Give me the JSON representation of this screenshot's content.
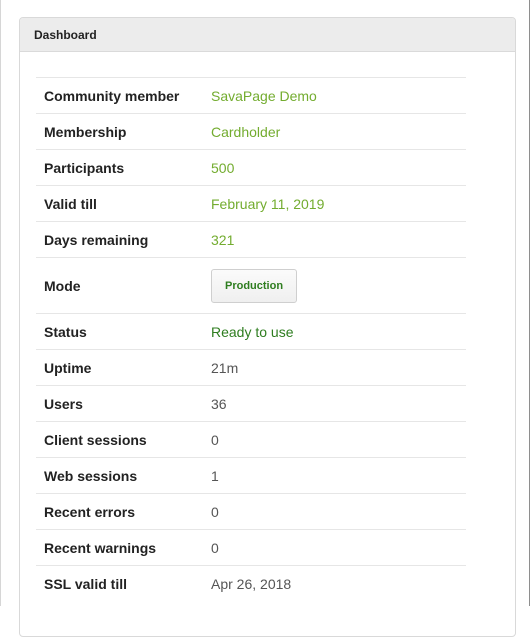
{
  "panel": {
    "title": "Dashboard"
  },
  "rows": {
    "community_member": {
      "label": "Community member",
      "value": "SavaPage Demo"
    },
    "membership": {
      "label": "Membership",
      "value": "Cardholder"
    },
    "participants": {
      "label": "Participants",
      "value": "500"
    },
    "valid_till": {
      "label": "Valid till",
      "value": "February 11, 2019"
    },
    "days_remaining": {
      "label": "Days remaining",
      "value": "321"
    },
    "mode": {
      "label": "Mode",
      "value": "Production"
    },
    "status": {
      "label": "Status",
      "value": "Ready to use"
    },
    "uptime": {
      "label": "Uptime",
      "value": "21m"
    },
    "users": {
      "label": "Users",
      "value": "36"
    },
    "client_sessions": {
      "label": "Client sessions",
      "value": "0"
    },
    "web_sessions": {
      "label": "Web sessions",
      "value": "1"
    },
    "recent_errors": {
      "label": "Recent errors",
      "value": "0"
    },
    "recent_warnings": {
      "label": "Recent warnings",
      "value": "0"
    },
    "ssl_valid_till": {
      "label": "SSL valid till",
      "value": "Apr 26, 2018"
    }
  },
  "colors": {
    "accent_green": "#73ac2f",
    "status_green": "#2e7d1f",
    "header_bg": "#ececec"
  }
}
